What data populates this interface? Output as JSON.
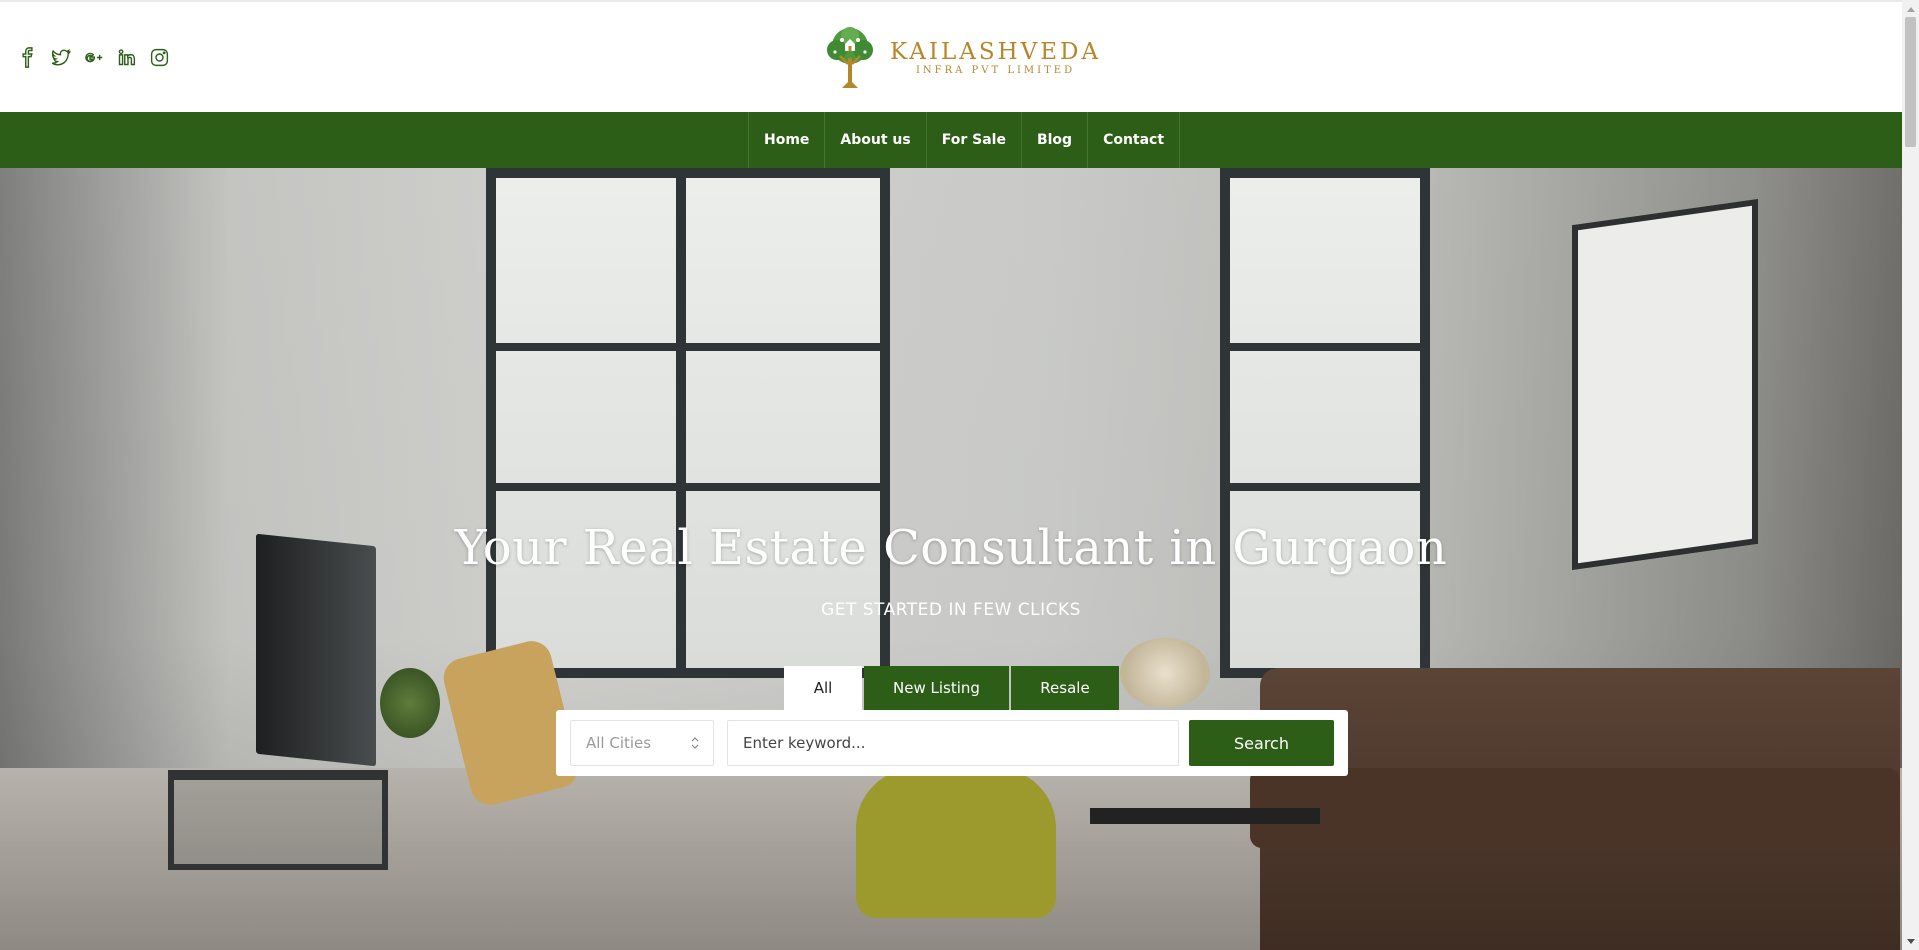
{
  "header": {
    "social_icons": [
      "facebook-icon",
      "twitter-icon",
      "google-plus-icon",
      "linkedin-icon",
      "instagram-icon"
    ],
    "logo": {
      "name": "KAILASHVEDA",
      "subtitle": "INFRA PVT LIMITED"
    }
  },
  "nav": {
    "items": [
      {
        "label": "Home"
      },
      {
        "label": "About us"
      },
      {
        "label": "For Sale"
      },
      {
        "label": "Blog"
      },
      {
        "label": "Contact"
      }
    ]
  },
  "hero": {
    "title": "Your Real Estate Consultant in Gurgaon",
    "subtitle": "GET STARTED IN FEW CLICKS",
    "tabs": [
      {
        "label": "All",
        "active": true
      },
      {
        "label": "New Listing",
        "active": false
      },
      {
        "label": "Resale",
        "active": false
      }
    ],
    "search": {
      "city_selected": "All Cities",
      "keyword_placeholder": "Enter keyword...",
      "button_label": "Search"
    }
  },
  "colors": {
    "brand_green": "#2c5e17",
    "logo_gold": "#b8862a"
  }
}
